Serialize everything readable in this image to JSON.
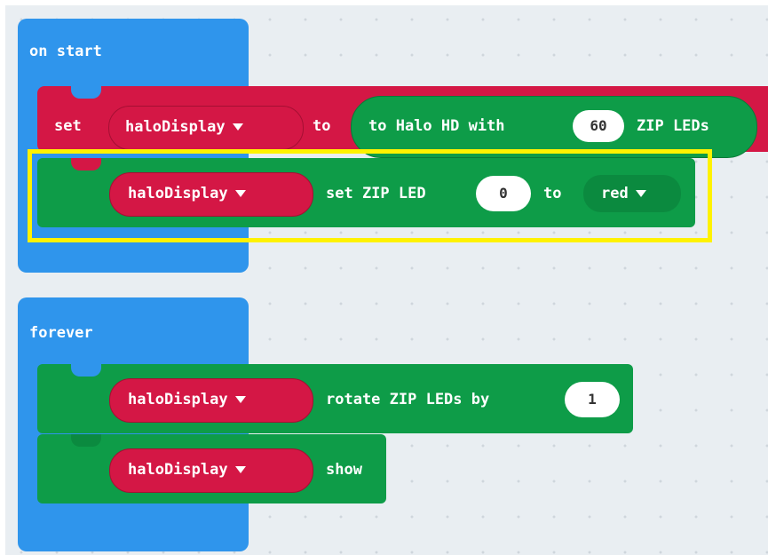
{
  "on_start": {
    "label": "on start",
    "set_block": {
      "set_label": "set",
      "variable": "haloDisplay",
      "to_label": "to",
      "constructor": {
        "prefix": "to Halo HD with",
        "count": "60",
        "suffix": "ZIP LEDs"
      }
    },
    "set_led_block": {
      "variable": "haloDisplay",
      "label": "set ZIP LED",
      "index": "0",
      "to_label": "to",
      "color": "red"
    }
  },
  "forever": {
    "label": "forever",
    "rotate_block": {
      "variable": "haloDisplay",
      "label": "rotate ZIP LEDs by",
      "amount": "1"
    },
    "show_block": {
      "variable": "haloDisplay",
      "label": "show"
    }
  },
  "colors": {
    "event_blue": "#2f95ec",
    "variable_red": "#d41745",
    "neopixel_green": "#0e9c48",
    "highlight_yellow": "#fff200",
    "workspace": "#e9eef2"
  }
}
